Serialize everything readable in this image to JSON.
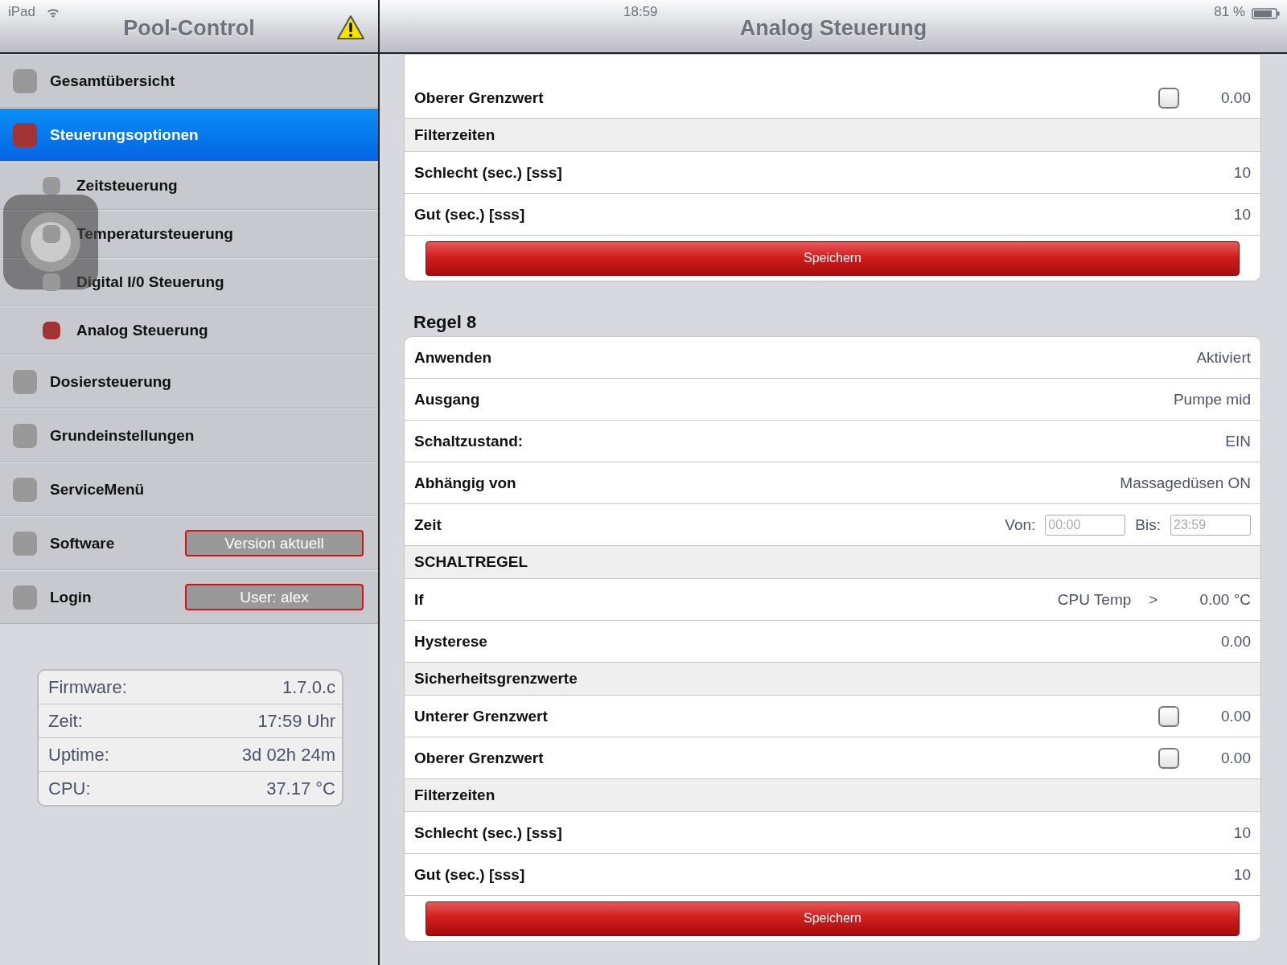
{
  "status_bar": {
    "device": "iPad",
    "time": "18:59",
    "battery": "81 %"
  },
  "sidebar": {
    "title": "Pool-Control",
    "items": [
      {
        "label": "Gesamtübersicht",
        "color": "#999999",
        "selected": false
      },
      {
        "label": "Steuerungsoptionen",
        "color": "#a23434",
        "selected": true,
        "children": [
          {
            "label": "Zeitsteuerung",
            "color": "#999999",
            "selected": false
          },
          {
            "label": "Temperatursteuerung",
            "color": "#999999",
            "selected": false
          },
          {
            "label": "Digital I/0 Steuerung",
            "color": "#999999",
            "selected": false
          },
          {
            "label": "Analog Steuerung",
            "color": "#a23434",
            "selected": false
          }
        ]
      },
      {
        "label": "Dosiersteuerung",
        "color": "#999999",
        "selected": false
      },
      {
        "label": "Grundeinstellungen",
        "color": "#999999",
        "selected": false
      },
      {
        "label": "ServiceMenü",
        "color": "#999999",
        "selected": false
      },
      {
        "label": "Software",
        "color": "#999999",
        "selected": false,
        "button": "Version aktuell"
      },
      {
        "label": "Login",
        "color": "#999999",
        "selected": false,
        "button": "User: alex"
      }
    ],
    "info": [
      {
        "label": "Firmware:",
        "value": "1.7.0.c"
      },
      {
        "label": "Zeit:",
        "value": "17:59 Uhr"
      },
      {
        "label": "Uptime:",
        "value": "3d 02h 24m"
      },
      {
        "label": "CPU:",
        "value": "37.17 °C"
      }
    ]
  },
  "main": {
    "title": "Analog Steuerung",
    "rules": [
      {
        "rows": [
          {
            "kind": "limit",
            "label": "Oberer Grenzwert",
            "checked": false,
            "value": "0.00"
          },
          {
            "kind": "section",
            "label": "Filterzeiten"
          },
          {
            "kind": "value",
            "label": "Schlecht (sec.) [sss]",
            "value": "10"
          },
          {
            "kind": "value",
            "label": "Gut (sec.) [sss]",
            "value": "10"
          },
          {
            "kind": "button",
            "label": "Speichern"
          }
        ]
      },
      {
        "heading": "Regel 8",
        "rows": [
          {
            "kind": "value",
            "label": "Anwenden",
            "value": "Aktiviert"
          },
          {
            "kind": "value",
            "label": "Ausgang",
            "value": "Pumpe mid"
          },
          {
            "kind": "value",
            "label": "Schaltzustand:",
            "value": "EIN"
          },
          {
            "kind": "value",
            "label": "Abhängig von",
            "value": "Massagedüsen ON"
          },
          {
            "kind": "time",
            "label": "Zeit",
            "from_label": "Von:",
            "from_placeholder": "00:00",
            "to_label": "Bis:",
            "to_placeholder": "23:59"
          },
          {
            "kind": "section",
            "label": "SCHALTREGEL"
          },
          {
            "kind": "condition",
            "label": "If",
            "source": "CPU Temp",
            "operator": ">",
            "value": "0.00 °C"
          },
          {
            "kind": "value",
            "label": "Hysterese",
            "value": "0.00"
          },
          {
            "kind": "section",
            "label": "Sicherheitsgrenzwerte"
          },
          {
            "kind": "limit",
            "label": "Unterer Grenzwert",
            "checked": false,
            "value": "0.00"
          },
          {
            "kind": "limit",
            "label": "Oberer Grenzwert",
            "checked": false,
            "value": "0.00"
          },
          {
            "kind": "section",
            "label": "Filterzeiten"
          },
          {
            "kind": "value",
            "label": "Schlecht (sec.) [sss]",
            "value": "10"
          },
          {
            "kind": "value",
            "label": "Gut (sec.) [sss]",
            "value": "10"
          },
          {
            "kind": "button",
            "label": "Speichern"
          }
        ]
      }
    ]
  }
}
